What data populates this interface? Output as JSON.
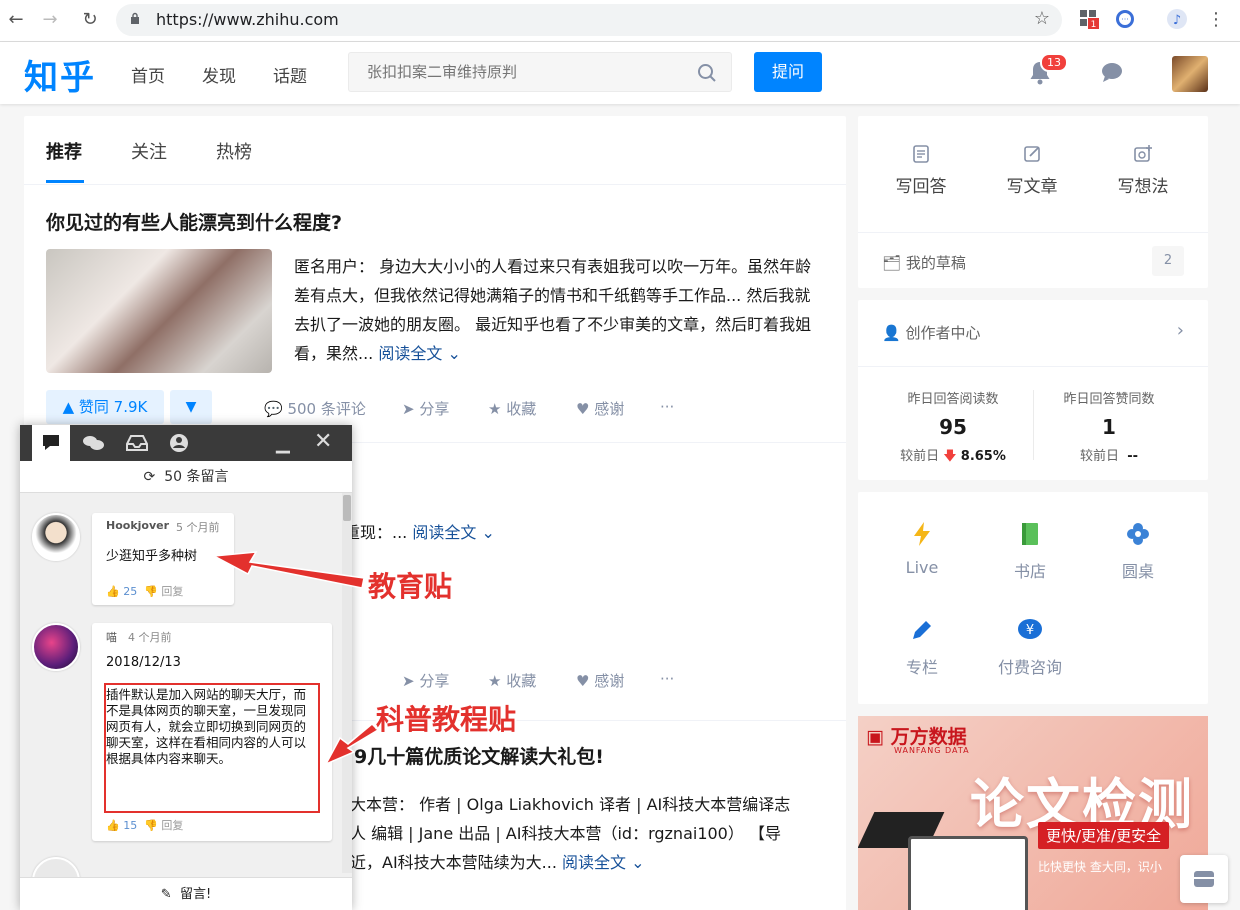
{
  "browser": {
    "url": "https://www.zhihu.com"
  },
  "header": {
    "logo": "知乎",
    "nav": [
      "首页",
      "发现",
      "话题"
    ],
    "search_placeholder": "张扣扣案二审维持原判",
    "ask_label": "提问",
    "notification_count": "13",
    "accent": "#0084ff"
  },
  "feed": {
    "tabs": [
      "推荐",
      "关注",
      "热榜"
    ],
    "item1": {
      "title": "你见过的有些人能漂亮到什么程度?",
      "excerpt": "匿名用户： 身边大大小小的人看过来只有表姐我可以吹一万年。虽然年龄差有点大，但我依然记得她满箱子的情书和千纸鹤等手工作品... 然后我就去扒了一波她的朋友圈。 最近知乎也看了不少审美的文章，然后盯着我姐看，果然...",
      "read_more": "阅读全文",
      "vote": "▲ 赞同 7.9K",
      "comments": "500 条评论",
      "share": "分享",
      "favorite": "收藏",
      "thanks": "感谢",
      "more": "···"
    },
    "item2": {
      "excerpt_tail": "重现：...",
      "read_more": "阅读全文",
      "share": "分享",
      "favorite": "收藏",
      "thanks": "感谢",
      "more": "···"
    },
    "item3": {
      "title_tail": "9几十篇优质论文解读大礼包!",
      "line1": "大本营： 作者 | Olga Liakhovich 译者 | AI科技大本营编译志",
      "line2": "人 编辑 | Jane 出品 | AI科技大本营（id：rgznai100） 【导",
      "line3": "近，AI科技大本营陆续为大...",
      "read_more": "阅读全文"
    }
  },
  "sidebar": {
    "write_answer": "写回答",
    "write_article": "写文章",
    "write_idea": "写想法",
    "drafts": "我的草稿",
    "drafts_count": "2",
    "creator_center": "创作者中心",
    "stats": [
      {
        "label": "昨日回答阅读数",
        "value": "95",
        "compare_label": "较前日",
        "compare_value": "8.65%"
      },
      {
        "label": "昨日回答赞同数",
        "value": "1",
        "compare_label": "较前日",
        "compare_value": "--"
      }
    ],
    "tools": [
      "Live",
      "书店",
      "圆桌",
      "专栏",
      "付费咨询"
    ]
  },
  "ad": {
    "brand": "万方数据",
    "brand_sub": "WANFANG DATA",
    "headline": "论文检测",
    "button": "更快/更准/更安全",
    "slogan": "比快更快 查大同，识小"
  },
  "chat_panel": {
    "message_count": "50 条留言",
    "comments": [
      {
        "user": "Hookjover",
        "time": "5 个月前",
        "text": "少逛知乎多种树",
        "likes": "25",
        "reply": "回复"
      },
      {
        "user": "喵",
        "time": "4 个月前",
        "date": "2018/12/13",
        "text": "插件默认是加入网站的聊天大厅，而不是具体网页的聊天室，一旦发现同网页有人，就会立即切换到同网页的聊天室，这样在看相同内容的人可以根据具体内容来聊天。",
        "likes": "15",
        "reply": "回复"
      }
    ],
    "compose": "留言!"
  },
  "annotations": {
    "edu": "教育贴",
    "tutorial": "科普教程贴"
  }
}
